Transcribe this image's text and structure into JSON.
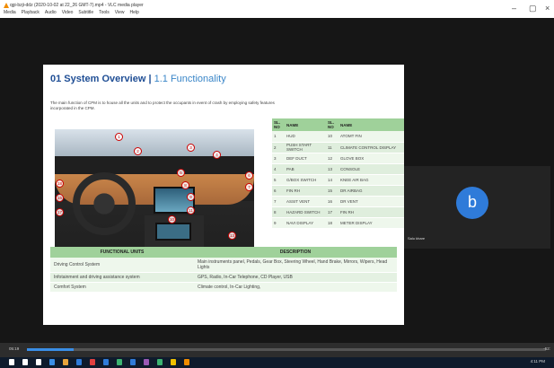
{
  "window": {
    "title": "qgi-bzji-ddz (2020-10-02 at 22_26 GMT-7).mp4 - VLC media player",
    "menus": [
      "Media",
      "Playback",
      "Audio",
      "Video",
      "Subtitle",
      "Tools",
      "View",
      "Help"
    ],
    "controls": [
      "–",
      "▢",
      "×"
    ]
  },
  "slide": {
    "title_main": "01 System Overview",
    "title_sep": "|",
    "title_sub": "1.1 Functionality",
    "intro": "The main function of CPM is to house all the units and to protect the occupants in event of crash by employing safety features incorporated in the CPM.",
    "callouts": [
      "1",
      "2",
      "3",
      "4",
      "5",
      "6",
      "7",
      "8",
      "9",
      "10",
      "11",
      "13",
      "15",
      "16",
      "17",
      "18"
    ],
    "component_table": {
      "headers": [
        "SL. NO",
        "NAME",
        "SL. NO",
        "NAME"
      ],
      "rows": [
        [
          "1",
          "HUD",
          "10",
          "ATOMT FIN"
        ],
        [
          "2",
          "PUSH START SWITCH",
          "11",
          "CLIMATE CONTROL DISPLAY"
        ],
        [
          "3",
          "DEF DUCT",
          "12",
          "GLOVE BOX"
        ],
        [
          "4",
          "PAB",
          "13",
          "CONSOLE"
        ],
        [
          "5",
          "G/BOX SWITCH",
          "14",
          "KNEE AIR BAG"
        ],
        [
          "6",
          "FIN RH",
          "15",
          "DR AIRBAG"
        ],
        [
          "7",
          "ASSIT VENT",
          "16",
          "DR VENT"
        ],
        [
          "8",
          "HAZARD SWITCH",
          "17",
          "FIN RH"
        ],
        [
          "9",
          "NAVI DISPLAY",
          "18",
          "METER DISPLAY"
        ]
      ]
    },
    "functional_table": {
      "headers": [
        "FUNCTIONAL UNITS",
        "DESCRIPTION"
      ],
      "rows": [
        [
          "Driving Control System",
          "Main instruments panel, Pedals, Gear Box, Steering Wheel, Hand Brake, Mirrors, Wipers, Head Lights"
        ],
        [
          "Infotainment and driving assistance system",
          "GPS, Radio, In-Car Telephone, CD Player, USB"
        ],
        [
          "Comfort System",
          "Climate control, In-Car Lighting,"
        ]
      ]
    }
  },
  "participant": {
    "initial": "b",
    "name": "Salu khare",
    "avatar_color": "#2f7bd9"
  },
  "player": {
    "elapsed": "05:19",
    "remaining": "-52:",
    "progress": 0.09
  },
  "taskbar": {
    "time": "4:11 PM",
    "icon_colors": [
      "#ffffff",
      "#ffffff",
      "#ffffff",
      "#3a8ee6",
      "#e8a33b",
      "#2f7bd9",
      "#e04040",
      "#2f7bd9",
      "#3cb371",
      "#2f7bd9",
      "#9b59b6",
      "#3cb371",
      "#f0c000",
      "#f08c00"
    ]
  }
}
